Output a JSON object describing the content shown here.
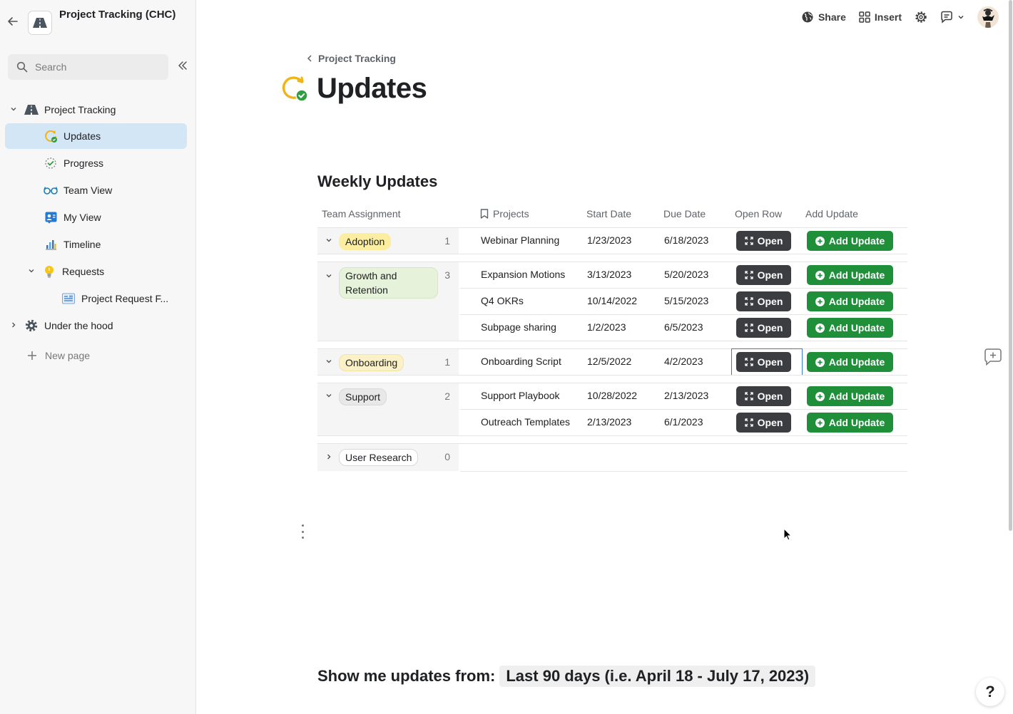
{
  "doc": {
    "title": "Project Tracking (CHC)"
  },
  "sidebar": {
    "search_placeholder": "Search",
    "items": [
      {
        "label": "Project Tracking",
        "icon": "road-icon"
      },
      {
        "label": "Updates",
        "icon": "updates-icon",
        "active": true
      },
      {
        "label": "Progress",
        "icon": "progress-icon"
      },
      {
        "label": "Team View",
        "icon": "glasses-icon"
      },
      {
        "label": "My View",
        "icon": "person-card-icon"
      },
      {
        "label": "Timeline",
        "icon": "timeline-chart-icon"
      },
      {
        "label": "Requests",
        "icon": "lightbulb-icon"
      },
      {
        "label": "Project Request F...",
        "icon": "form-icon"
      },
      {
        "label": "Under the hood",
        "icon": "gear-icon"
      }
    ],
    "new_page": "New page"
  },
  "topbar": {
    "share": "Share",
    "insert": "Insert"
  },
  "breadcrumb": "Project Tracking",
  "page": {
    "title": "Updates"
  },
  "section": {
    "title": "Weekly Updates"
  },
  "table": {
    "headers": [
      "Team Assignment",
      "Projects",
      "Start Date",
      "Due Date",
      "Open Row",
      "Add Update"
    ],
    "open_label": "Open",
    "add_label": "Add Update",
    "groups": [
      {
        "name": "Adoption",
        "count": "1",
        "color": "#fbeea0",
        "rows": [
          {
            "project": "Webinar Planning",
            "start": "1/23/2023",
            "due": "6/18/2023"
          }
        ]
      },
      {
        "name": "Growth and Retention",
        "count": "3",
        "color": "#e7f2da",
        "rows": [
          {
            "project": "Expansion Motions",
            "start": "3/13/2023",
            "due": "5/20/2023"
          },
          {
            "project": "Q4 OKRs",
            "start": "10/14/2022",
            "due": "5/15/2023"
          },
          {
            "project": "Subpage sharing",
            "start": "1/2/2023",
            "due": "6/5/2023"
          }
        ]
      },
      {
        "name": "Onboarding",
        "count": "1",
        "color": "#fbf1c6",
        "rows": [
          {
            "project": "Onboarding Script",
            "start": "12/5/2022",
            "due": "4/2/2023"
          }
        ]
      },
      {
        "name": "Support",
        "count": "2",
        "color": "#e8e8e8",
        "rows": [
          {
            "project": "Support Playbook",
            "start": "10/28/2022",
            "due": "2/13/2023"
          },
          {
            "project": "Outreach Templates",
            "start": "2/13/2023",
            "due": "6/1/2023"
          }
        ]
      },
      {
        "name": "User Research",
        "count": "0",
        "color": "#ffffff",
        "rows": []
      }
    ]
  },
  "filter": {
    "label": "Show me updates from:",
    "value": "Last 90 days (i.e. April 18 - July 17, 2023)"
  },
  "help": "?"
}
